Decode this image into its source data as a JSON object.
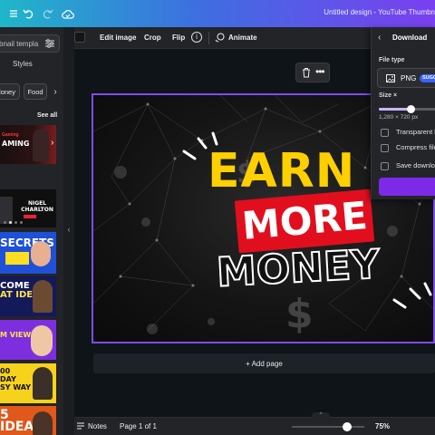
{
  "topbar": {
    "title": "Untitled design - YouTube Thumbn",
    "icons": [
      "menu-icon",
      "undo-icon",
      "redo-icon",
      "cloud-save-icon"
    ]
  },
  "sidebar": {
    "search_placeholder": "bnail templa",
    "styles_label": "Styles",
    "chips": [
      "loney",
      "Food"
    ],
    "see_all": "See all",
    "thumbnails": [
      {
        "text": "AMING",
        "subtext": "Gaming"
      },
      {
        "text": "NIGEL CHARLTON"
      },
      {
        "text": "SECRETS"
      },
      {
        "text": "COME",
        "text2": "AT IDEAS"
      },
      {
        "text": "M VIEWS"
      },
      {
        "text": "00",
        "text2": "DAY",
        "text3": "SY WAY"
      },
      {
        "text": "5",
        "text2": "IDEAS"
      }
    ]
  },
  "toolbar": {
    "edit_image": "Edit image",
    "crop": "Crop",
    "flip": "Flip",
    "info": "i",
    "animate": "Animate"
  },
  "design": {
    "line1": "EARN",
    "line2": "MORE",
    "line3": "MONEY",
    "colors": {
      "earn": "#ffd000",
      "more_bg": "#e10f1e",
      "selection": "#7b4df2"
    }
  },
  "canvas": {
    "add_page": "+ Add page"
  },
  "bottombar": {
    "notes": "Notes",
    "page": "Page 1 of 1",
    "zoom": "75%",
    "zoom_value": 0.75
  },
  "download_panel": {
    "title": "Download",
    "file_type_label": "File type",
    "file_type": "PNG",
    "suggested_badge": "SUGG",
    "size_label": "Size ×",
    "size_dims": "1,280 × 720 px",
    "size_fraction": 0.5,
    "options": [
      "Transparent ba",
      "Compress file",
      "Save download"
    ]
  }
}
